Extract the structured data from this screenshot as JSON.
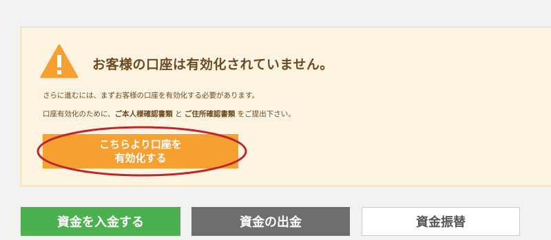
{
  "notice": {
    "title": "お客様の口座は有効化されていません。",
    "line1": "さらに進むには、まずお客様の口座を有効化する必要があります。",
    "line2_prefix": "口座有効化のために、",
    "line2_doc1": "ご本人様確認書類",
    "line2_and": " と ",
    "line2_doc2": "ご住所確認書類",
    "line2_suffix": " をご提出下さい。",
    "icon": "warning-icon"
  },
  "activate_button": {
    "line1": "こちらより口座を",
    "line2": "有効化する"
  },
  "actions": {
    "deposit_label": "資金を入金する",
    "withdraw_label": "資金の出金",
    "transfer_label": "資金振替"
  },
  "colors": {
    "panel_bg": "#fdf3e1",
    "accent_orange": "#f5a030",
    "deposit_green": "#4caf50",
    "withdraw_gray": "#6e6e6e",
    "annotation_red": "#c0242c"
  }
}
